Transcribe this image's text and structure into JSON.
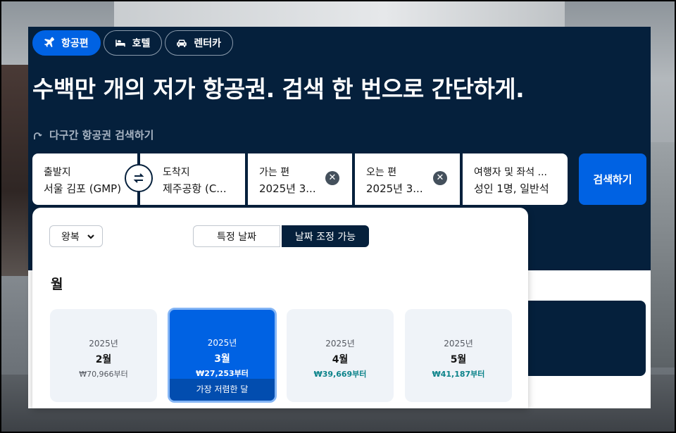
{
  "tabs": [
    {
      "label": "항공편",
      "icon": "airplane-icon",
      "active": true
    },
    {
      "label": "호텔",
      "icon": "bed-icon",
      "active": false
    },
    {
      "label": "렌터카",
      "icon": "car-icon",
      "active": false
    }
  ],
  "headline": "수백만 개의 저가 항공권. 검색 한 번으로 간단하게.",
  "multi_city_link": "다구간 항공권 검색하기",
  "search": {
    "origin_label": "출발지",
    "origin_value": "서울 김포 (GMP)",
    "destination_label": "도착지",
    "destination_value": "제주공항 (C...",
    "depart_label": "가는 편",
    "depart_value": "2025년 3...",
    "return_label": "오는 편",
    "return_value": "2025년 3...",
    "travellers_label": "여행자 및 좌석 ...",
    "travellers_value": "성인 1명, 일반석",
    "search_button": "검색하기"
  },
  "calendar": {
    "trip_type": "왕복",
    "mode_specific": "특정 날짜",
    "mode_flexible": "날짜 조정 가능",
    "active_mode": "flexible",
    "month_heading": "월",
    "months": [
      {
        "year": "2025년",
        "month": "2월",
        "price": "₩70,966부터",
        "selected": false
      },
      {
        "year": "2025년",
        "month": "3월",
        "price": "₩27,253부터",
        "selected": true,
        "badge": "가장 저렴한 달"
      },
      {
        "year": "2025년",
        "month": "4월",
        "price": "₩39,669부터",
        "selected": false
      },
      {
        "year": "2025년",
        "month": "5월",
        "price": "₩41,187부터",
        "selected": false
      }
    ]
  },
  "colors": {
    "hero_bg": "#05203c",
    "primary_blue": "#0062e3",
    "price_teal": "#0c838a"
  }
}
